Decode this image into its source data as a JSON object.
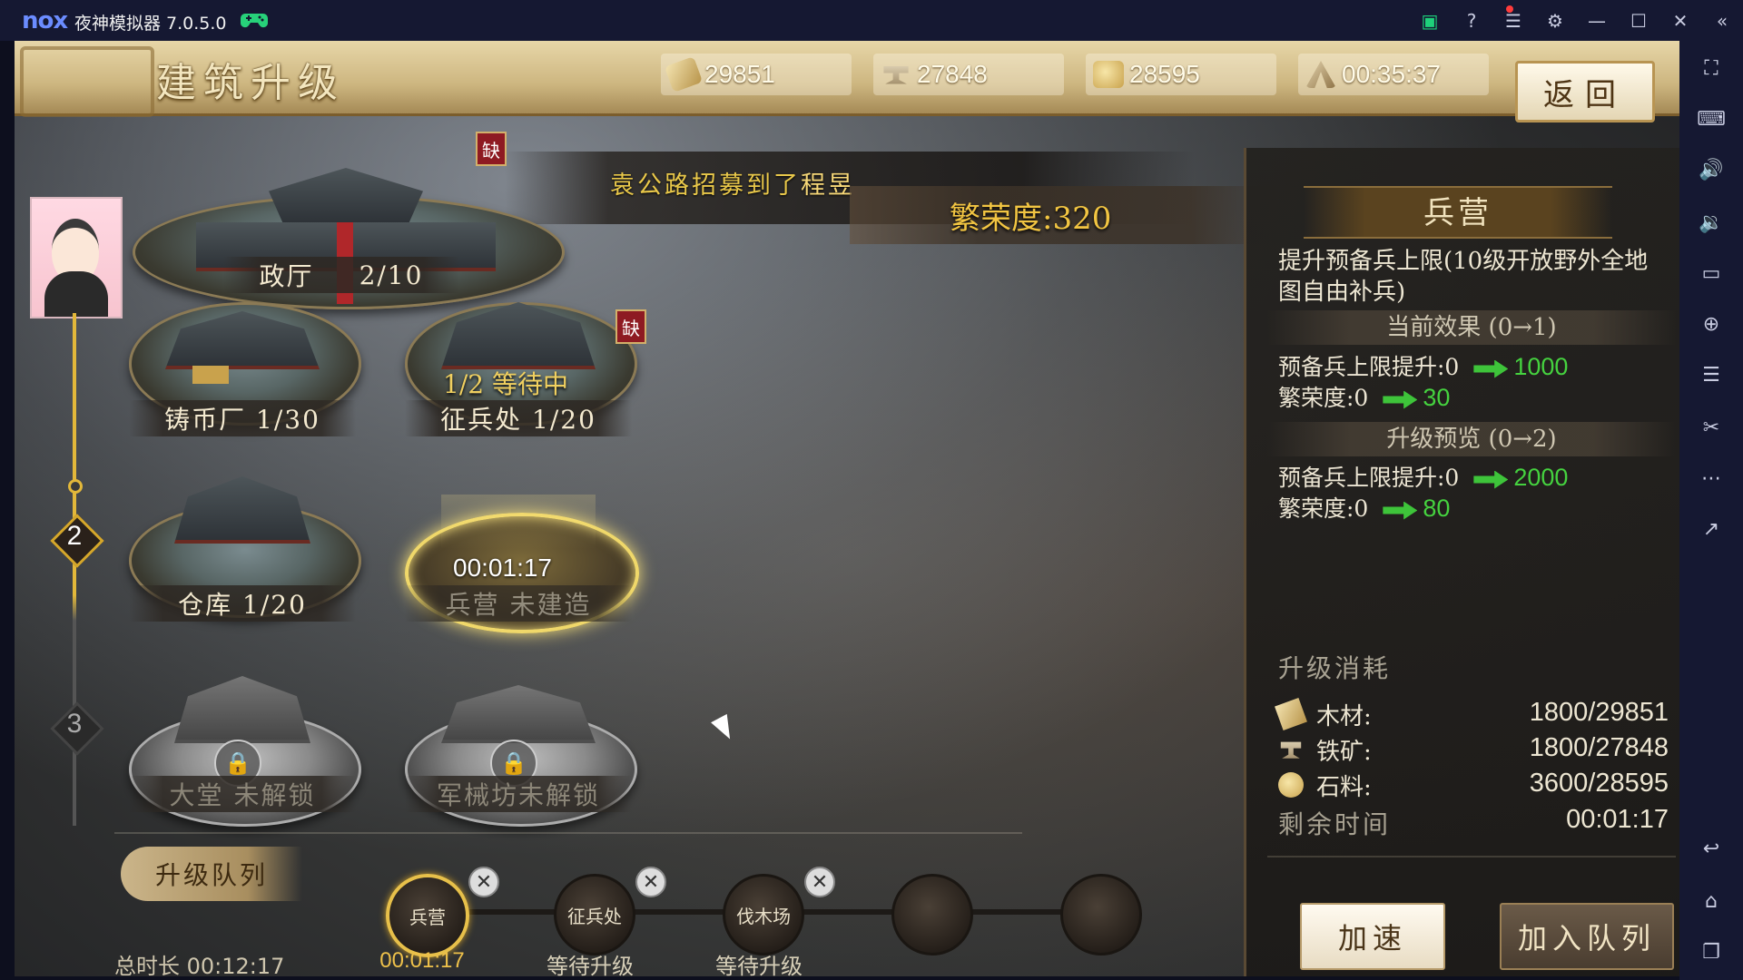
{
  "emulator": {
    "logo": "nox",
    "title": "夜神模拟器 7.0.5.0",
    "titlebar_icons": [
      "app-store-icon",
      "help-icon",
      "menu-icon",
      "settings-icon",
      "minimize-icon",
      "maximize-icon",
      "close-icon",
      "collapse-sidebar-icon"
    ],
    "sidebar_icons": [
      "fullscreen-icon",
      "keyboard-icon",
      "volume-up-icon",
      "volume-down-icon",
      "screen-icon",
      "install-apk-icon",
      "multi-instance-icon",
      "screenshot-icon",
      "more-icon",
      "share-icon",
      "back-icon",
      "home-icon",
      "recent-apps-icon"
    ]
  },
  "header": {
    "title": "建筑升级",
    "resources": {
      "wood": "29851",
      "iron": "27848",
      "stone": "28595",
      "timer": "00:35:37"
    },
    "back_label": "返回"
  },
  "banner": {
    "recruit_prefix": "袁公路招募到了",
    "recruit_name": "程昱",
    "prosperity": "繁荣度:320"
  },
  "timeline": {
    "level_2": "2",
    "level_3": "3"
  },
  "buildings": {
    "hall": {
      "name": "政厅",
      "level": "2/10",
      "tag": "缺"
    },
    "mint": {
      "label": "铸币厂 1/30"
    },
    "conscription": {
      "label": "征兵处 1/20",
      "status": "1/2 等待中",
      "tag": "缺"
    },
    "warehouse": {
      "label": "仓库 1/20"
    },
    "barracks": {
      "label": "兵营 未建造",
      "timer": "00:01:17"
    },
    "locked1": {
      "label": "大堂 未解锁"
    },
    "locked2": {
      "label": "军械坊未解锁"
    }
  },
  "queue": {
    "title": "升级队列",
    "total": "总时长  00:12:17",
    "slots": [
      {
        "name": "兵营",
        "status": "00:01:17"
      },
      {
        "name": "征兵处",
        "status": "等待升级"
      },
      {
        "name": "伐木场",
        "status": "等待升级"
      }
    ],
    "remove_glyph": "✕"
  },
  "panel": {
    "title": "兵营",
    "description": "提升预备兵上限(10级开放野外全地图自由补兵)",
    "current_header": "当前效果 (0→1)",
    "current": [
      {
        "label": "预备兵上限提升:0",
        "value": "1000"
      },
      {
        "label": "繁荣度:0",
        "value": "30"
      }
    ],
    "preview_header": "升级预览 (0→2)",
    "preview": [
      {
        "label": "预备兵上限提升:0",
        "value": "2000"
      },
      {
        "label": "繁荣度:0",
        "value": "80"
      }
    ],
    "cost_header": "升级消耗",
    "costs": [
      {
        "label": "木材:",
        "value": "1800/29851"
      },
      {
        "label": "铁矿:",
        "value": "1800/27848"
      },
      {
        "label": "石料:",
        "value": "3600/28595"
      }
    ],
    "remain_label": "剩余时间",
    "remain_value": "00:01:17",
    "speed_label": "加速",
    "join_label": "加入队列"
  }
}
